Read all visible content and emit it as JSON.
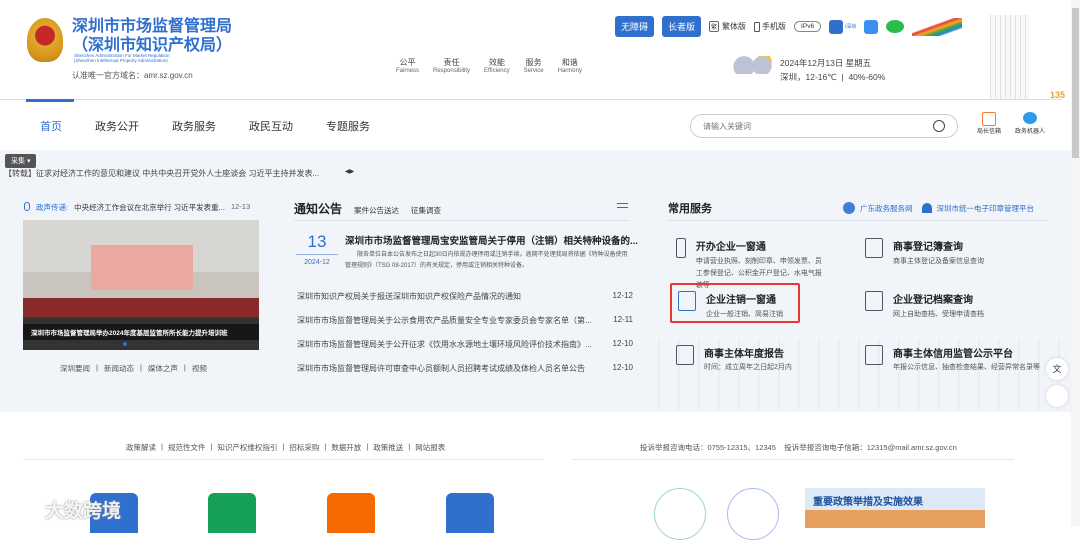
{
  "header": {
    "title_line1": "深圳市市场监督管理局",
    "title_line2": "（深圳市知识产权局）",
    "en_line1": "Shenzhen Administration For Market Regulation",
    "en_line2": "(Shenzhen Intellectual Property Administration)",
    "domain_note": "认准唯一官方域名：amr.sz.gov.cn",
    "values": [
      {
        "cn": "公平",
        "en": "Fairness"
      },
      {
        "cn": "责任",
        "en": "Responsibility"
      },
      {
        "cn": "效能",
        "en": "Efficiency"
      },
      {
        "cn": "服务",
        "en": "Service"
      },
      {
        "cn": "和谐",
        "en": "Harmony"
      }
    ],
    "tools": {
      "accessible": "无障碍",
      "elder": "长者版",
      "traditional": "繁体版",
      "traditional_icon": "繁",
      "mobile": "手机版",
      "ipv6": "IPv6",
      "app": "i深圳"
    },
    "weather": {
      "date": "2024年12月13日 星期五",
      "detail": "深圳，12-16℃  |  40%-60%"
    },
    "badge135": "135"
  },
  "nav": {
    "items": [
      "首页",
      "政务公开",
      "政务服务",
      "政民互动",
      "专题服务"
    ],
    "search_placeholder": "请输入关键词",
    "mailbox": "局长信箱",
    "robot": "政务机器人"
  },
  "ticker": {
    "tag": "采集",
    "text": "【转载】征求对经济工作的意见和建议 中共中央召开党外人士座谈会 习近平主持并发表..."
  },
  "news": {
    "label": "政声传递:",
    "headline": "中央经济工作会议在北京举行 习近平发表重...",
    "date": "12-13",
    "caption": "深圳市市场监督管理局举办2024年度基层监管所所长能力提升培训班",
    "tabs": [
      "深圳要闻",
      "新闻动态",
      "媒体之声",
      "视频"
    ]
  },
  "notice": {
    "title": "通知公告",
    "tabs": [
      "案件公告送达",
      "征集调查"
    ],
    "top": {
      "day": "13",
      "month": "2024-12",
      "title": "深圳市市场监督管理局宝安监管局关于停用（注销）相关特种设备的...",
      "summary": "限各单位自本公告发布之日起30日内依规办理停用或注销手续。逾期不处理我局将依据《特种设备使用管理规则》（TSG 08-2017）的有关规定，停用或注销相关特种设备。"
    },
    "items": [
      {
        "t": "深圳市知识产权局关于报送深圳市知识产权保险产品情况的通知",
        "d": "12-12"
      },
      {
        "t": "深圳市市场监督管理局关于公示食用农产品质量安全专业专家委员会专家名单（第...",
        "d": "12-11"
      },
      {
        "t": "深圳市市场监督管理局关于公开征求《饮用水水源地土壤环境风险评价技术指南》...",
        "d": "12-10"
      },
      {
        "t": "深圳市市场监督管理局许可审查中心员额制人员招聘考试成绩及体检人员名单公告",
        "d": "12-10"
      }
    ]
  },
  "services": {
    "title": "常用服务",
    "link1": "广东政务服务网",
    "link2": "深圳市统一电子印章管理平台",
    "items": [
      {
        "t": "开办企业一窗通",
        "d": "申请营业执照、刻制印章、申领发票、员工参保登记、公积金开户登记、水电气报装等"
      },
      {
        "t": "商事登记簿查询",
        "d": "商事主体登记及备案信息查询"
      },
      {
        "t": "企业注销一窗通",
        "d": "企业一般注销、简易注销"
      },
      {
        "t": "企业登记档案查询",
        "d": "网上自助查档、受理申请查档"
      },
      {
        "t": "商事主体年度报告",
        "d": "时间：成立周年之日起2月内"
      },
      {
        "t": "商事主体信用监管公示平台",
        "d": "年报公示信息、抽查检查结果、经营异常名录等"
      }
    ]
  },
  "footer": {
    "links": [
      "政策解读",
      "规范性文件",
      "知识产权维权指引",
      "招标采购",
      "数据开放",
      "政策推送",
      "网站报表"
    ],
    "contact": "投诉举报咨询电话：0755-12315、12345    投诉举报咨询电子信箱：12315@mail.amr.sz.gov.cn",
    "banner": "重要政策举措及实施效果",
    "watermark": "大数跨境"
  },
  "colors": {
    "brand": "#2f6fce",
    "highlight": "#e53935",
    "bg": "#f1f4f9"
  }
}
